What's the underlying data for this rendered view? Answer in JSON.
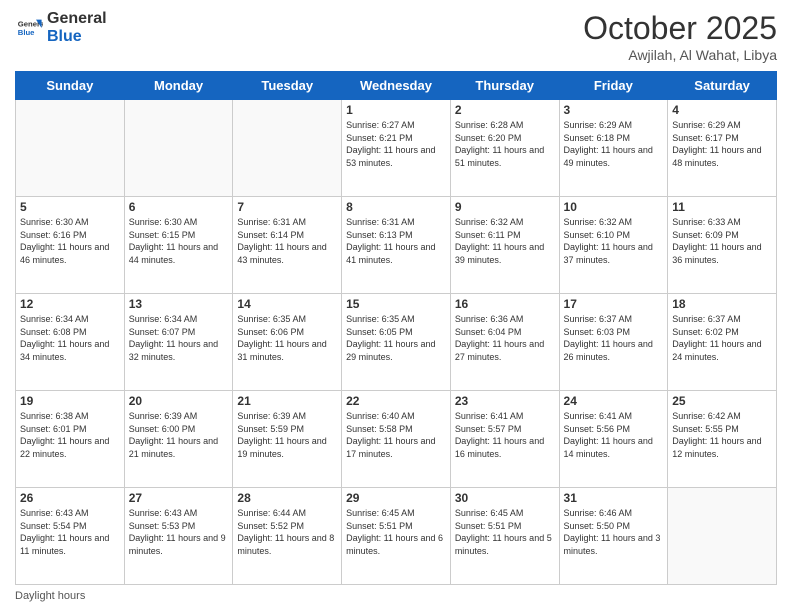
{
  "header": {
    "logo_line1": "General",
    "logo_line2": "Blue",
    "month_title": "October 2025",
    "subtitle": "Awjilah, Al Wahat, Libya"
  },
  "days_of_week": [
    "Sunday",
    "Monday",
    "Tuesday",
    "Wednesday",
    "Thursday",
    "Friday",
    "Saturday"
  ],
  "weeks": [
    [
      {
        "day": "",
        "info": ""
      },
      {
        "day": "",
        "info": ""
      },
      {
        "day": "",
        "info": ""
      },
      {
        "day": "1",
        "info": "Sunrise: 6:27 AM\nSunset: 6:21 PM\nDaylight: 11 hours and 53 minutes."
      },
      {
        "day": "2",
        "info": "Sunrise: 6:28 AM\nSunset: 6:20 PM\nDaylight: 11 hours and 51 minutes."
      },
      {
        "day": "3",
        "info": "Sunrise: 6:29 AM\nSunset: 6:18 PM\nDaylight: 11 hours and 49 minutes."
      },
      {
        "day": "4",
        "info": "Sunrise: 6:29 AM\nSunset: 6:17 PM\nDaylight: 11 hours and 48 minutes."
      }
    ],
    [
      {
        "day": "5",
        "info": "Sunrise: 6:30 AM\nSunset: 6:16 PM\nDaylight: 11 hours and 46 minutes."
      },
      {
        "day": "6",
        "info": "Sunrise: 6:30 AM\nSunset: 6:15 PM\nDaylight: 11 hours and 44 minutes."
      },
      {
        "day": "7",
        "info": "Sunrise: 6:31 AM\nSunset: 6:14 PM\nDaylight: 11 hours and 43 minutes."
      },
      {
        "day": "8",
        "info": "Sunrise: 6:31 AM\nSunset: 6:13 PM\nDaylight: 11 hours and 41 minutes."
      },
      {
        "day": "9",
        "info": "Sunrise: 6:32 AM\nSunset: 6:11 PM\nDaylight: 11 hours and 39 minutes."
      },
      {
        "day": "10",
        "info": "Sunrise: 6:32 AM\nSunset: 6:10 PM\nDaylight: 11 hours and 37 minutes."
      },
      {
        "day": "11",
        "info": "Sunrise: 6:33 AM\nSunset: 6:09 PM\nDaylight: 11 hours and 36 minutes."
      }
    ],
    [
      {
        "day": "12",
        "info": "Sunrise: 6:34 AM\nSunset: 6:08 PM\nDaylight: 11 hours and 34 minutes."
      },
      {
        "day": "13",
        "info": "Sunrise: 6:34 AM\nSunset: 6:07 PM\nDaylight: 11 hours and 32 minutes."
      },
      {
        "day": "14",
        "info": "Sunrise: 6:35 AM\nSunset: 6:06 PM\nDaylight: 11 hours and 31 minutes."
      },
      {
        "day": "15",
        "info": "Sunrise: 6:35 AM\nSunset: 6:05 PM\nDaylight: 11 hours and 29 minutes."
      },
      {
        "day": "16",
        "info": "Sunrise: 6:36 AM\nSunset: 6:04 PM\nDaylight: 11 hours and 27 minutes."
      },
      {
        "day": "17",
        "info": "Sunrise: 6:37 AM\nSunset: 6:03 PM\nDaylight: 11 hours and 26 minutes."
      },
      {
        "day": "18",
        "info": "Sunrise: 6:37 AM\nSunset: 6:02 PM\nDaylight: 11 hours and 24 minutes."
      }
    ],
    [
      {
        "day": "19",
        "info": "Sunrise: 6:38 AM\nSunset: 6:01 PM\nDaylight: 11 hours and 22 minutes."
      },
      {
        "day": "20",
        "info": "Sunrise: 6:39 AM\nSunset: 6:00 PM\nDaylight: 11 hours and 21 minutes."
      },
      {
        "day": "21",
        "info": "Sunrise: 6:39 AM\nSunset: 5:59 PM\nDaylight: 11 hours and 19 minutes."
      },
      {
        "day": "22",
        "info": "Sunrise: 6:40 AM\nSunset: 5:58 PM\nDaylight: 11 hours and 17 minutes."
      },
      {
        "day": "23",
        "info": "Sunrise: 6:41 AM\nSunset: 5:57 PM\nDaylight: 11 hours and 16 minutes."
      },
      {
        "day": "24",
        "info": "Sunrise: 6:41 AM\nSunset: 5:56 PM\nDaylight: 11 hours and 14 minutes."
      },
      {
        "day": "25",
        "info": "Sunrise: 6:42 AM\nSunset: 5:55 PM\nDaylight: 11 hours and 12 minutes."
      }
    ],
    [
      {
        "day": "26",
        "info": "Sunrise: 6:43 AM\nSunset: 5:54 PM\nDaylight: 11 hours and 11 minutes."
      },
      {
        "day": "27",
        "info": "Sunrise: 6:43 AM\nSunset: 5:53 PM\nDaylight: 11 hours and 9 minutes."
      },
      {
        "day": "28",
        "info": "Sunrise: 6:44 AM\nSunset: 5:52 PM\nDaylight: 11 hours and 8 minutes."
      },
      {
        "day": "29",
        "info": "Sunrise: 6:45 AM\nSunset: 5:51 PM\nDaylight: 11 hours and 6 minutes."
      },
      {
        "day": "30",
        "info": "Sunrise: 6:45 AM\nSunset: 5:51 PM\nDaylight: 11 hours and 5 minutes."
      },
      {
        "day": "31",
        "info": "Sunrise: 6:46 AM\nSunset: 5:50 PM\nDaylight: 11 hours and 3 minutes."
      },
      {
        "day": "",
        "info": ""
      }
    ]
  ],
  "footer": {
    "daylight_label": "Daylight hours"
  }
}
